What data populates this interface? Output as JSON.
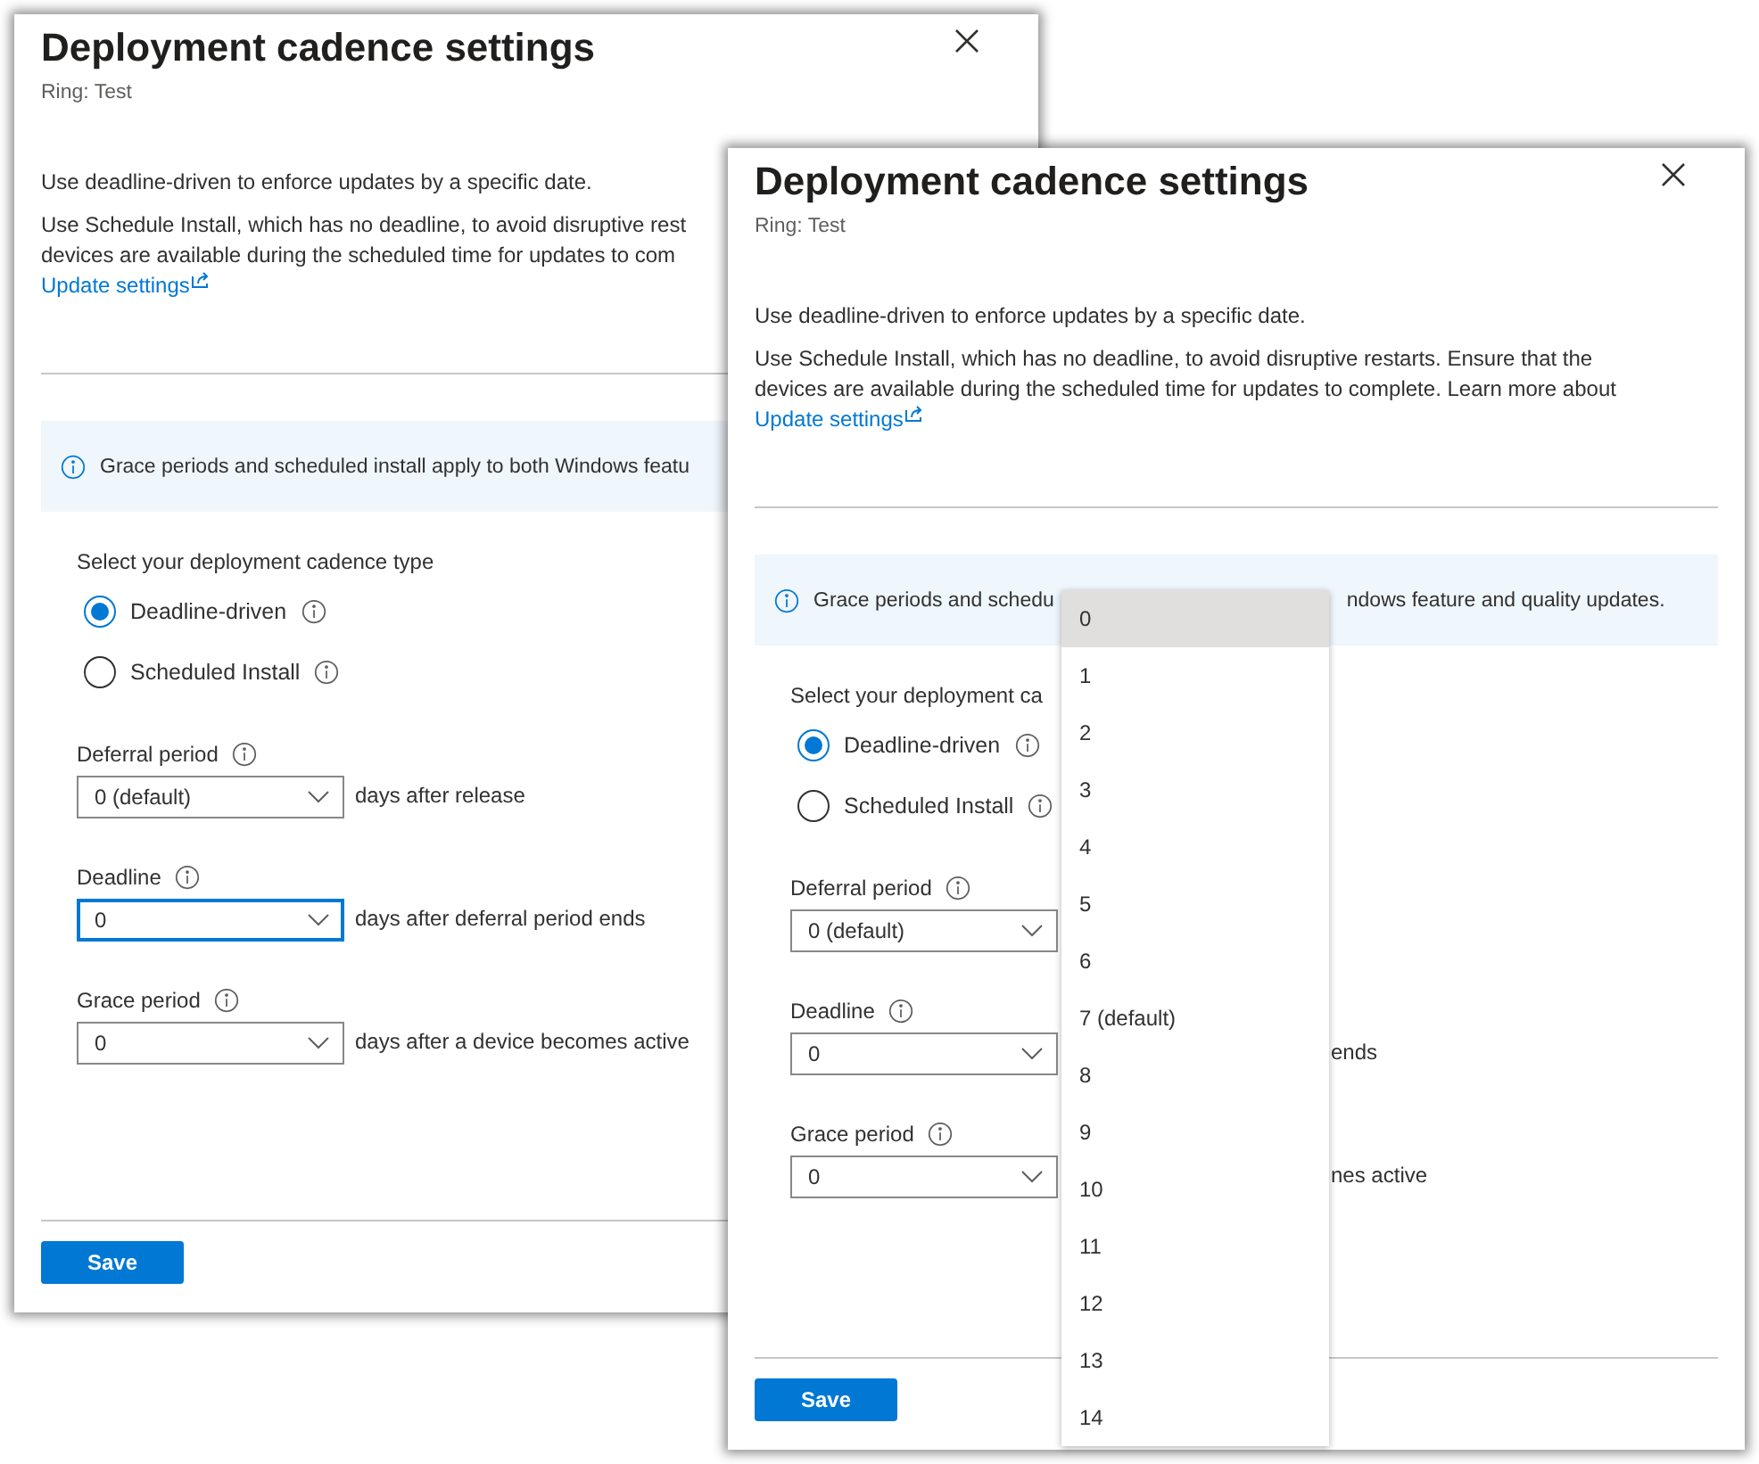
{
  "panels": [
    {
      "title": "Deployment cadence settings",
      "subtitle": "Ring: Test",
      "intro": "Use deadline-driven to enforce updates by a specific date.",
      "description": "Use Schedule Install, which has no deadline, to avoid disruptive rest\ndevices are available during the scheduled time for updates to com",
      "link": "Update settings",
      "info": [
        "Grace periods and scheduled install apply to both Windows featu"
      ],
      "cadence_label": "Select your deployment cadence type",
      "options": [
        {
          "label": "Deadline-driven",
          "selected": true
        },
        {
          "label": "Scheduled Install",
          "selected": false
        }
      ],
      "fields": [
        {
          "label": "Deferral period",
          "value": "0 (default)",
          "suffix": "days after release",
          "focused": false
        },
        {
          "label": "Deadline",
          "value": "0",
          "suffix": "days after deferral period ends",
          "focused": true
        },
        {
          "label": "Grace period",
          "value": "0",
          "suffix": "days after a device becomes active",
          "focused": false
        }
      ],
      "save": "Save"
    },
    {
      "title": "Deployment cadence settings",
      "subtitle": "Ring: Test",
      "intro": "Use deadline-driven to enforce updates by a specific date.",
      "description": "Use Schedule Install, which has no deadline, to avoid disruptive restarts. Ensure that the\ndevices are available during the scheduled time for updates to complete. Learn more about",
      "link": "Update settings",
      "info": [
        "Grace periods and schedu",
        "ndows feature and quality updates."
      ],
      "cadence_label": "Select your deployment ca",
      "options": [
        {
          "label": "Deadline-driven",
          "selected": true
        },
        {
          "label": "Scheduled Install",
          "selected": false
        }
      ],
      "fields": [
        {
          "label": "Deferral period",
          "value": "0 (default)",
          "focused": false
        },
        {
          "label": "Deadline",
          "value": "0",
          "suffix": "ends",
          "focused": false
        },
        {
          "label": "Grace period",
          "value": "0",
          "suffix": "nes active",
          "focused": false
        }
      ],
      "save": "Save",
      "dropdown": {
        "options": [
          {
            "label": "0",
            "selected": true
          },
          {
            "label": "1",
            "selected": false
          },
          {
            "label": "2",
            "selected": false
          },
          {
            "label": "3",
            "selected": false
          },
          {
            "label": "4",
            "selected": false
          },
          {
            "label": "5",
            "selected": false
          },
          {
            "label": "6",
            "selected": false
          },
          {
            "label": "7 (default)",
            "selected": false
          },
          {
            "label": "8",
            "selected": false
          },
          {
            "label": "9",
            "selected": false
          },
          {
            "label": "10",
            "selected": false
          },
          {
            "label": "11",
            "selected": false
          },
          {
            "label": "12",
            "selected": false
          },
          {
            "label": "13",
            "selected": false
          },
          {
            "label": "14",
            "selected": false
          }
        ]
      }
    }
  ]
}
